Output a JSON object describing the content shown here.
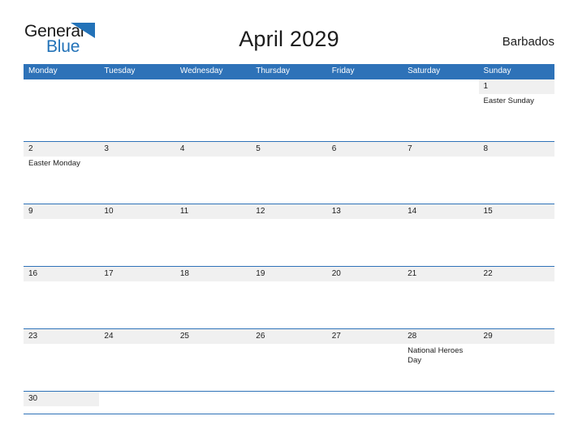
{
  "brand": {
    "name_top": "General",
    "name_bottom": "Blue",
    "flag_icon": "triangle-flag-icon",
    "top_color": "#1a1a1a",
    "bottom_color": "#2272b8"
  },
  "header": {
    "title": "April 2029",
    "country": "Barbados"
  },
  "colors": {
    "header_bar": "#2e72b8",
    "row_divider": "#2e72b8",
    "day_number_band": "#f0f0f0",
    "page_background": "#ffffff",
    "text": "#1c1c1c"
  },
  "calendar": {
    "month": "April",
    "year": "2029",
    "week_start": "Monday",
    "weekdays": [
      "Monday",
      "Tuesday",
      "Wednesday",
      "Thursday",
      "Friday",
      "Saturday",
      "Sunday"
    ],
    "weeks": [
      [
        {
          "day": "",
          "events": []
        },
        {
          "day": "",
          "events": []
        },
        {
          "day": "",
          "events": []
        },
        {
          "day": "",
          "events": []
        },
        {
          "day": "",
          "events": []
        },
        {
          "day": "",
          "events": []
        },
        {
          "day": "1",
          "events": [
            "Easter Sunday"
          ]
        }
      ],
      [
        {
          "day": "2",
          "events": [
            "Easter Monday"
          ]
        },
        {
          "day": "3",
          "events": []
        },
        {
          "day": "4",
          "events": []
        },
        {
          "day": "5",
          "events": []
        },
        {
          "day": "6",
          "events": []
        },
        {
          "day": "7",
          "events": []
        },
        {
          "day": "8",
          "events": []
        }
      ],
      [
        {
          "day": "9",
          "events": []
        },
        {
          "day": "10",
          "events": []
        },
        {
          "day": "11",
          "events": []
        },
        {
          "day": "12",
          "events": []
        },
        {
          "day": "13",
          "events": []
        },
        {
          "day": "14",
          "events": []
        },
        {
          "day": "15",
          "events": []
        }
      ],
      [
        {
          "day": "16",
          "events": []
        },
        {
          "day": "17",
          "events": []
        },
        {
          "day": "18",
          "events": []
        },
        {
          "day": "19",
          "events": []
        },
        {
          "day": "20",
          "events": []
        },
        {
          "day": "21",
          "events": []
        },
        {
          "day": "22",
          "events": []
        }
      ],
      [
        {
          "day": "23",
          "events": []
        },
        {
          "day": "24",
          "events": []
        },
        {
          "day": "25",
          "events": []
        },
        {
          "day": "26",
          "events": []
        },
        {
          "day": "27",
          "events": []
        },
        {
          "day": "28",
          "events": [
            "National Heroes Day"
          ]
        },
        {
          "day": "29",
          "events": []
        }
      ],
      [
        {
          "day": "30",
          "events": []
        },
        {
          "day": "",
          "events": []
        },
        {
          "day": "",
          "events": []
        },
        {
          "day": "",
          "events": []
        },
        {
          "day": "",
          "events": []
        },
        {
          "day": "",
          "events": []
        },
        {
          "day": "",
          "events": []
        }
      ]
    ]
  }
}
